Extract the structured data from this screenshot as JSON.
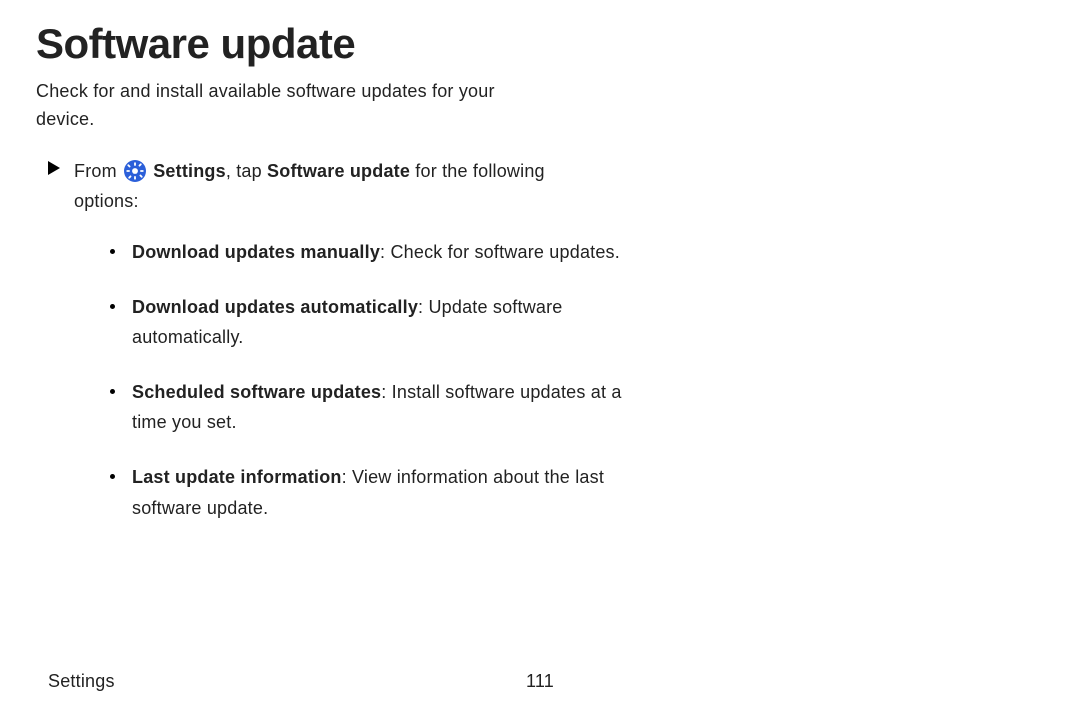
{
  "heading": "Software update",
  "subtitle": "Check for and install available software updates for your device.",
  "step": {
    "prefix": "From ",
    "settings_label": "Settings",
    "mid": ", tap ",
    "target": "Software update",
    "suffix": " for the following options:"
  },
  "options": [
    {
      "term": "Download updates manually",
      "desc": ": Check for software updates."
    },
    {
      "term": "Download updates automatically",
      "desc": ": Update software automatically."
    },
    {
      "term": "Scheduled software updates",
      "desc": ": Install software updates at a time you set."
    },
    {
      "term": "Last update information",
      "desc": ": View information about the last software update."
    }
  ],
  "footer": {
    "section": "Settings",
    "page": "111"
  },
  "colors": {
    "icon_bg": "#2b5fd9"
  }
}
